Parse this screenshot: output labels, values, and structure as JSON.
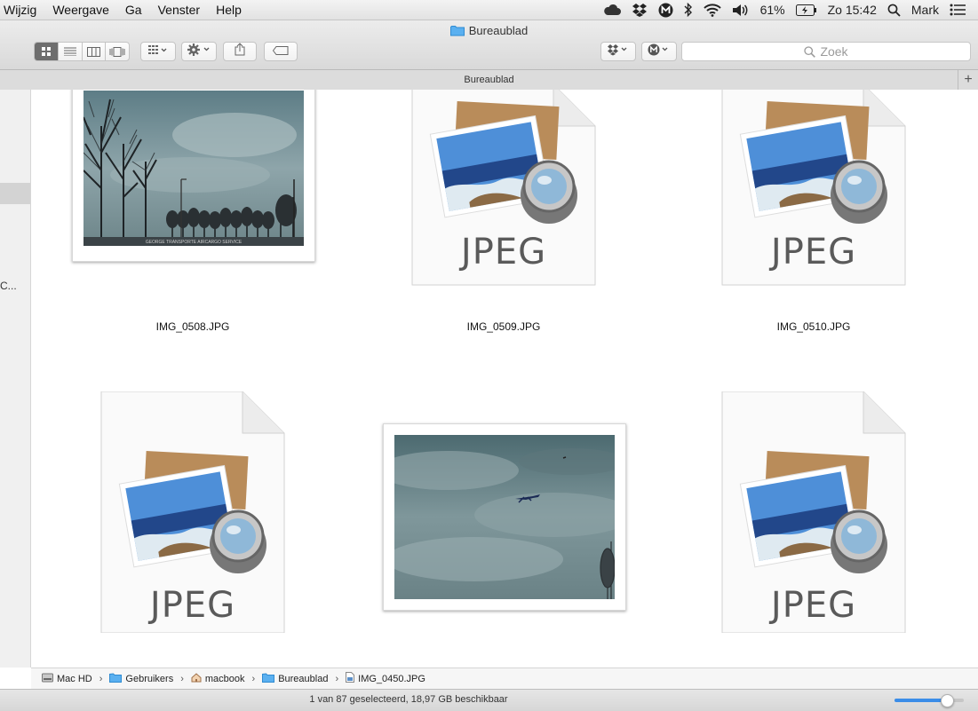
{
  "menubar": {
    "items": [
      "Wijzig",
      "Weergave",
      "Ga",
      "Venster",
      "Help"
    ],
    "battery": "61%",
    "clock": "Zo 15:42",
    "user": "Mark"
  },
  "window": {
    "title": "Bureaublad",
    "tab_label": "Bureaublad",
    "search_placeholder": "Zoek"
  },
  "sidebar": {
    "truncated_label": "C..."
  },
  "files": [
    {
      "name": "IMG_0508.JPG",
      "kind": "photo-trees"
    },
    {
      "name": "IMG_0509.JPG",
      "kind": "jpeg-icon"
    },
    {
      "name": "IMG_0510.JPG",
      "kind": "jpeg-icon"
    },
    {
      "name": "",
      "kind": "jpeg-icon"
    },
    {
      "name": "",
      "kind": "photo-plane"
    },
    {
      "name": "",
      "kind": "jpeg-icon"
    }
  ],
  "jpeg_label": "JPEG",
  "thumb_caption": "GEORGE TRANSPORTE AIRCARGO SERVICE",
  "pathbar": {
    "segments": [
      "Mac HD",
      "Gebruikers",
      "macbook",
      "Bureaublad",
      "IMG_0450.JPG"
    ]
  },
  "status": {
    "text": "1 van 87 geselecteerd, 18,97 GB beschikbaar",
    "zoom_level": 0.75
  },
  "colors": {
    "accent": "#3b8de8",
    "folder": "#5ab0f0"
  }
}
